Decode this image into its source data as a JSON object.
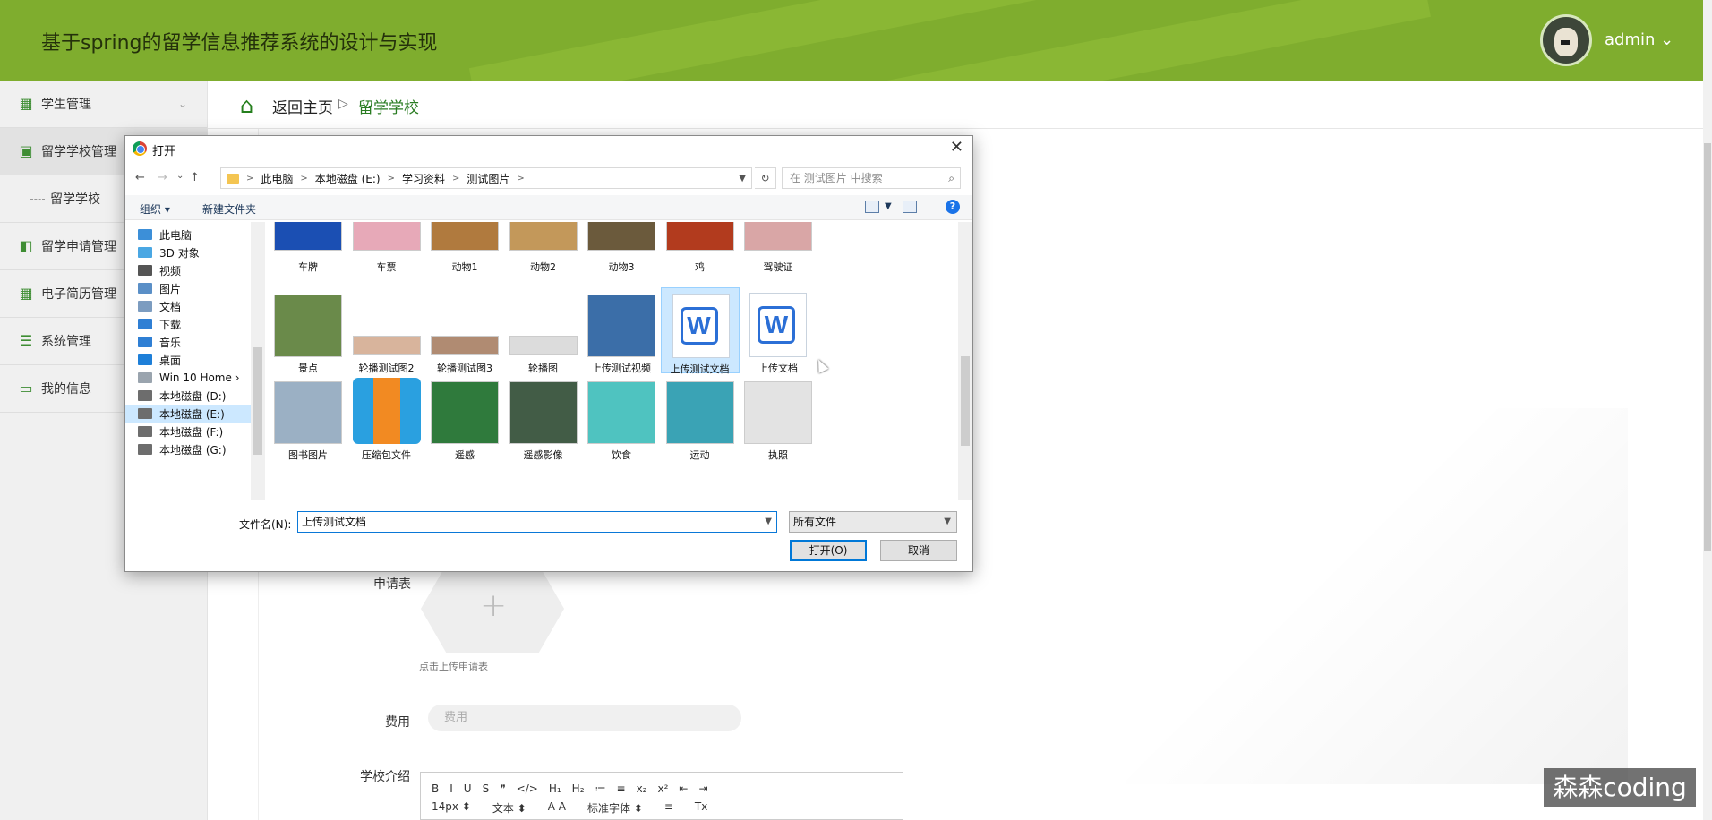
{
  "app": {
    "title": "基于spring的留学信息推荐系统的设计与实现",
    "user": "admin ⌄"
  },
  "sidebar": {
    "items": [
      {
        "label": "学生管理",
        "icon": "grid-icon",
        "chevron": "⌄"
      },
      {
        "label": "留学学校管理",
        "icon": "clipboard-icon"
      },
      {
        "label": "留学学校",
        "sub": true
      },
      {
        "label": "留学申请管理",
        "icon": "ticket-icon"
      },
      {
        "label": "电子简历管理",
        "icon": "grid-icon"
      },
      {
        "label": "系统管理",
        "icon": "list-icon"
      },
      {
        "label": "我的信息",
        "icon": "card-icon"
      }
    ]
  },
  "breadcrumb": {
    "home": "返回主页",
    "sep": "▷",
    "current": "留学学校"
  },
  "form": {
    "apply_label": "申请表",
    "upload_plus": "+",
    "upload_hint": "点击上传申请表",
    "fee_label": "费用",
    "fee_placeholder": "费用",
    "intro_label": "学校介绍",
    "editor_row1": [
      "B",
      "I",
      "U",
      "S",
      "❞",
      "</>",
      "H₁",
      "H₂",
      "≔",
      "≡",
      "x₂",
      "x²",
      "⇤",
      "⇥"
    ],
    "editor_row2": [
      "14px ⬍",
      "文本 ⬍",
      "A A",
      "标准字体 ⬍",
      "≡",
      "Tx"
    ]
  },
  "watermark": "森森coding",
  "dialog": {
    "title": "打开",
    "close": "✕",
    "nav": {
      "back": "←",
      "forward": "→",
      "recent": "⌄",
      "up": "↑"
    },
    "address": [
      "此电脑",
      "本地磁盘 (E:)",
      "学习资料",
      "测试图片"
    ],
    "address_sep": ">",
    "refresh": "↻",
    "search_placeholder": "在 测试图片 中搜索",
    "search_icon": "⌕",
    "toolbar": {
      "organize": "组织 ▾",
      "new_folder": "新建文件夹",
      "help": "?"
    },
    "nav_pane": [
      {
        "label": "此电脑",
        "color": "#3c8fd8"
      },
      {
        "label": "3D 对象",
        "color": "#4aa7e3"
      },
      {
        "label": "视频",
        "color": "#555555"
      },
      {
        "label": "图片",
        "color": "#5a8fc7"
      },
      {
        "label": "文档",
        "color": "#7c9cc0"
      },
      {
        "label": "下载",
        "color": "#2f7fd4"
      },
      {
        "label": "音乐",
        "color": "#2f7fd4"
      },
      {
        "label": "桌面",
        "color": "#1e7fd8"
      },
      {
        "label": "Win 10 Home ›",
        "color": "#9aa4ae"
      },
      {
        "label": "本地磁盘 (D:)",
        "color": "#6d6d6d"
      },
      {
        "label": "本地磁盘 (E:)",
        "color": "#6d6d6d",
        "selected": true
      },
      {
        "label": "本地磁盘 (F:)",
        "color": "#6d6d6d"
      },
      {
        "label": "本地磁盘 (G:)",
        "color": "#6d6d6d"
      }
    ],
    "files": [
      {
        "label": "车牌",
        "thumb": "#1b4fb3"
      },
      {
        "label": "车票",
        "thumb": "#e7a9b8"
      },
      {
        "label": "动物1",
        "thumb": "#b07a3e"
      },
      {
        "label": "动物2",
        "thumb": "#c3985a"
      },
      {
        "label": "动物3",
        "thumb": "#6b5a3c"
      },
      {
        "label": "鸡",
        "thumb": "#b23b1e"
      },
      {
        "label": "驾驶证",
        "thumb": "#d9a6a6"
      },
      {
        "label": "景点",
        "thumb": "#6a8a4a"
      },
      {
        "label": "轮播测试图2",
        "thumb": "#d8b49c"
      },
      {
        "label": "轮播测试图3",
        "thumb": "#b08b72"
      },
      {
        "label": "轮播图",
        "thumb": "#dcdcdc"
      },
      {
        "label": "上传测试视频",
        "thumb": "#3b6ea8"
      },
      {
        "label": "上传测试文档",
        "thumb": "word",
        "selected": true
      },
      {
        "label": "上传文档",
        "thumb": "word"
      },
      {
        "label": "图书图片",
        "thumb": "#9bb0c4"
      },
      {
        "label": "压缩包文件",
        "thumb": "zip"
      },
      {
        "label": "遥感",
        "thumb": "#2f7a3c"
      },
      {
        "label": "遥感影像",
        "thumb": "#425c46"
      },
      {
        "label": "饮食",
        "thumb": "#4fc3c0"
      },
      {
        "label": "运动",
        "thumb": "#3aa3b5"
      },
      {
        "label": "执照",
        "thumb": "#e3e3e3"
      }
    ],
    "filename_label": "文件名(N):",
    "filename_value": "上传测试文档",
    "filter_value": "所有文件",
    "open_button": "打开(O)",
    "cancel_button": "取消"
  },
  "colors": {
    "topbar": "#7fad2e",
    "accent": "#2a7c22",
    "dialog_select": "#cce8ff"
  }
}
